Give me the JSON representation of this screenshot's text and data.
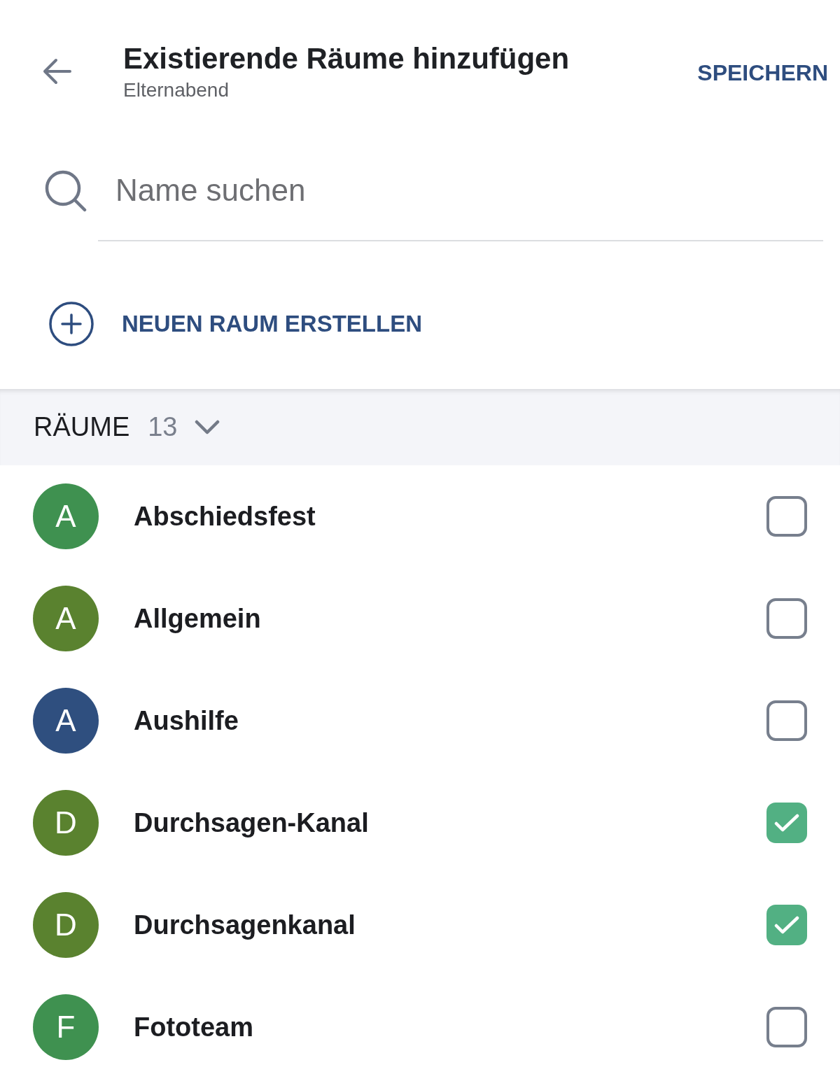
{
  "header": {
    "title": "Existierende Räume hinzufügen",
    "subtitle": "Elternabend",
    "action": "SPEICHERN"
  },
  "search": {
    "placeholder": "Name suchen"
  },
  "create_button": {
    "label": "NEUEN RAUM ERSTELLEN"
  },
  "section": {
    "title": "RÄUME",
    "count": "13"
  },
  "rooms": [
    {
      "initial": "A",
      "name": "Abschiedsfest",
      "color": "#3f9150",
      "checked": false
    },
    {
      "initial": "A",
      "name": "Allgemein",
      "color": "#5a822f",
      "checked": false
    },
    {
      "initial": "A",
      "name": "Aushilfe",
      "color": "#2f4f7f",
      "checked": false
    },
    {
      "initial": "D",
      "name": "Durchsagen-Kanal",
      "color": "#5a822f",
      "checked": true
    },
    {
      "initial": "D",
      "name": "Durchsagenkanal",
      "color": "#5a822f",
      "checked": true
    },
    {
      "initial": "F",
      "name": "Fototeam",
      "color": "#3f9150",
      "checked": false
    }
  ]
}
